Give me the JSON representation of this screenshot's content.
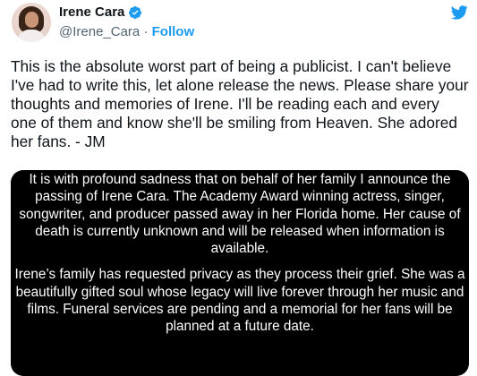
{
  "author": {
    "display_name": "Irene Cara",
    "handle": "@Irene_Cara",
    "separator": "·",
    "follow_label": "Follow",
    "verified": true,
    "avatar_icon": "profile-photo"
  },
  "tweet": {
    "text": "This is the absolute worst part of being a publicist. I can't believe I've had to write this, let alone release the news. Please share your thoughts and memories of Irene. I'll be reading each and every one of them and know she'll be smiling from Heaven. She adored her fans. - JM"
  },
  "media": {
    "statement_paragraphs": [
      "It is with profound sadness that on behalf of her family I announce the passing of Irene Cara. The Academy Award winning actress, singer, songwriter, and producer passed away in her Florida home. Her cause of death is currently unknown and will be released when information is available.",
      "Irene’s family has requested privacy as they process their grief. She was a beautifully gifted soul whose legacy will live forever through her music and films. Funeral services are pending and a memorial for her fans will be planned at a future date."
    ]
  },
  "colors": {
    "accent": "#1d9bf0",
    "text": "#0f1419",
    "secondary": "#536471",
    "media_bg": "#000000"
  },
  "icons": {
    "brand": "twitter-bird-icon",
    "verified": "verified-badge-icon"
  }
}
